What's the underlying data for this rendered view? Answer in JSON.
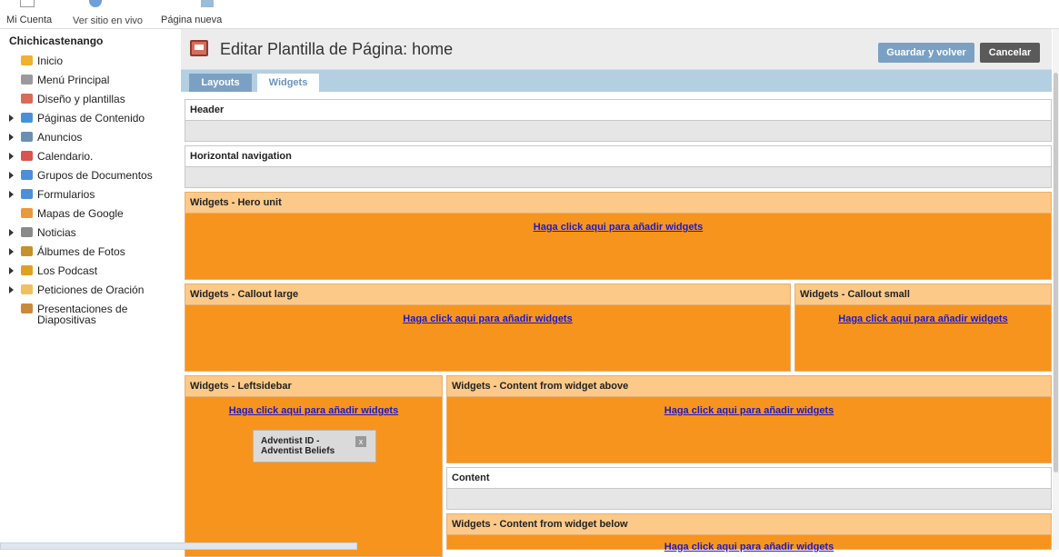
{
  "topbar": {
    "links": [
      "Mi Cuenta",
      "Ver sitio en vivo",
      "Página nueva"
    ]
  },
  "sidebar": {
    "site_name": "Chichicastenango",
    "items": [
      {
        "label": "Inicio",
        "icon": "home-icon",
        "expandable": false,
        "color": "#f0b030"
      },
      {
        "label": "Menú Principal",
        "icon": "menu-icon",
        "expandable": false,
        "color": "#9a9a9a"
      },
      {
        "label": "Diseño y plantillas",
        "icon": "template-icon",
        "expandable": false,
        "color": "#d96b5a"
      },
      {
        "label": "Páginas de Contenido",
        "icon": "pages-icon",
        "expandable": true,
        "color": "#4a90d9"
      },
      {
        "label": "Anuncios",
        "icon": "megaphone-icon",
        "expandable": true,
        "color": "#6b8fb3"
      },
      {
        "label": "Calendario.",
        "icon": "calendar-icon",
        "expandable": true,
        "color": "#d9534f"
      },
      {
        "label": "Grupos de Documentos",
        "icon": "documents-icon",
        "expandable": true,
        "color": "#4a90d9"
      },
      {
        "label": "Formularios",
        "icon": "forms-icon",
        "expandable": true,
        "color": "#4a90d9"
      },
      {
        "label": "Mapas de Google",
        "icon": "map-icon",
        "expandable": false,
        "color": "#e89a3c"
      },
      {
        "label": "Noticias",
        "icon": "news-icon",
        "expandable": true,
        "color": "#8a8a8a"
      },
      {
        "label": "Álbumes de Fotos",
        "icon": "photo-album-icon",
        "expandable": true,
        "color": "#c8902a"
      },
      {
        "label": "Los Podcast",
        "icon": "podcast-icon",
        "expandable": true,
        "color": "#e0a020"
      },
      {
        "label": "Peticiones de Oración",
        "icon": "prayer-icon",
        "expandable": true,
        "color": "#f0c060"
      },
      {
        "label": "Presentaciones de Diapositivas",
        "icon": "slideshow-icon",
        "expandable": false,
        "color": "#c88a3a"
      }
    ]
  },
  "main": {
    "title": "Editar Plantilla de Página: home",
    "save_label": "Guardar y volver",
    "cancel_label": "Cancelar",
    "tabs": [
      "Layouts",
      "Widgets"
    ],
    "active_tab": "Widgets",
    "regions": {
      "header": "Header",
      "hnav": "Horizontal navigation",
      "hero": "Widgets - Hero unit",
      "callout_large": "Widgets - Callout large",
      "callout_small": "Widgets - Callout small",
      "leftsidebar": "Widgets - Leftsidebar",
      "content_above": "Widgets - Content from widget above",
      "content": "Content",
      "content_below": "Widgets - Content from widget below"
    },
    "add_widgets_label": "Haga click aqui para añadir widgets",
    "widget_card": "Adventist ID - Adventist Beliefs",
    "widget_close": "x"
  },
  "colors": {
    "accent_blue": "#7aa1c4",
    "widget_orange": "#f7941d",
    "header_orange": "#fcc988",
    "link_blue": "#1d1ac8"
  }
}
